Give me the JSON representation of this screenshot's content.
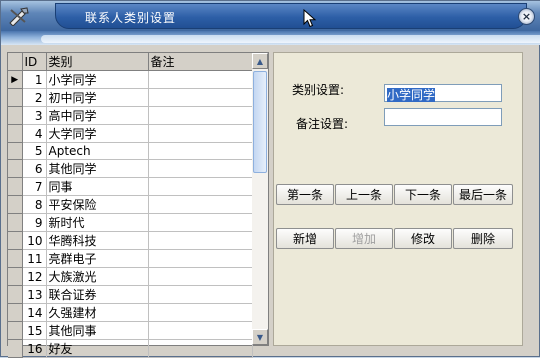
{
  "window": {
    "title": "联系人类别设置",
    "close_glyph": "×"
  },
  "grid": {
    "columns": [
      "ID",
      "类别",
      "备注"
    ],
    "rows": [
      {
        "id": "1",
        "category": "小学同学",
        "note": ""
      },
      {
        "id": "2",
        "category": "初中同学",
        "note": ""
      },
      {
        "id": "3",
        "category": "高中同学",
        "note": ""
      },
      {
        "id": "4",
        "category": "大学同学",
        "note": ""
      },
      {
        "id": "5",
        "category": "Aptech",
        "note": ""
      },
      {
        "id": "6",
        "category": "其他同学",
        "note": ""
      },
      {
        "id": "7",
        "category": "同事",
        "note": ""
      },
      {
        "id": "8",
        "category": "平安保险",
        "note": ""
      },
      {
        "id": "9",
        "category": "新时代",
        "note": ""
      },
      {
        "id": "10",
        "category": "华腾科技",
        "note": ""
      },
      {
        "id": "11",
        "category": "亮群电子",
        "note": ""
      },
      {
        "id": "12",
        "category": "大族激光",
        "note": ""
      },
      {
        "id": "13",
        "category": "联合证券",
        "note": ""
      },
      {
        "id": "14",
        "category": "久强建材",
        "note": ""
      },
      {
        "id": "15",
        "category": "其他同事",
        "note": ""
      },
      {
        "id": "16",
        "category": "好友",
        "note": ""
      }
    ],
    "current_row_marker": "▶",
    "scroll_up_glyph": "▲",
    "scroll_down_glyph": "▼"
  },
  "form": {
    "category_label": "类别设置:",
    "category_value": "小学同学",
    "note_label": "备注设置:",
    "note_value": ""
  },
  "nav_buttons": {
    "first": "第一条",
    "prev": "上一条",
    "next": "下一条",
    "last": "最后一条"
  },
  "action_buttons": {
    "add": "新增",
    "save": "增加",
    "edit": "修改",
    "delete": "删除"
  },
  "colors": {
    "title_bar": "#2d5fa7",
    "selection": "#316ac5",
    "panel": "#ece9d8"
  }
}
